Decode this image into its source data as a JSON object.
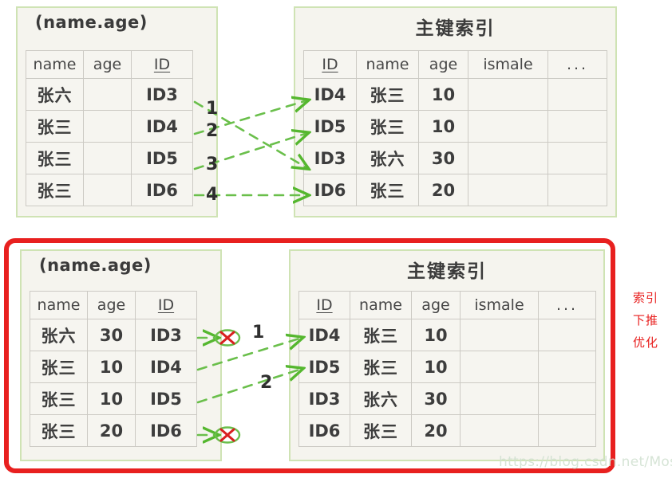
{
  "diagram": {
    "title_secondary_index": "(name.age)",
    "title_primary_index": "主键索引",
    "watermark": "https://blog.csdn.net/MosBest",
    "annotation_lines": [
      "索引",
      "下推",
      "优化"
    ],
    "colors": {
      "panel_border": "#cfe3b4",
      "panel_fill": "#f5f4ee",
      "arrow": "#6abf4b",
      "highlight_box": "#e8201f",
      "annotation_text": "#e8201f",
      "text": "#3d3d3d",
      "watermark": "#cfe0cf"
    }
  },
  "top": {
    "secondary_index": {
      "title": "(name.age)",
      "headers": [
        "name",
        "age",
        "ID"
      ],
      "rows": [
        [
          "张六",
          "",
          "ID3"
        ],
        [
          "张三",
          "",
          "ID4"
        ],
        [
          "张三",
          "",
          "ID5"
        ],
        [
          "张三",
          "",
          "ID6"
        ]
      ]
    },
    "primary_index": {
      "title": "主键索引",
      "headers": [
        "ID",
        "name",
        "age",
        "ismale",
        "..."
      ],
      "rows": [
        [
          "ID4",
          "张三",
          "10",
          "",
          ""
        ],
        [
          "ID5",
          "张三",
          "10",
          "",
          ""
        ],
        [
          "ID3",
          "张六",
          "30",
          "",
          ""
        ],
        [
          "ID6",
          "张三",
          "20",
          "",
          ""
        ]
      ]
    },
    "step_labels": [
      "1",
      "2",
      "3",
      "4"
    ],
    "lookups": [
      {
        "label": "1",
        "from_row": 0,
        "from_id": "ID3",
        "to_row": 2,
        "to_id": "ID3",
        "blocked": false
      },
      {
        "label": "2",
        "from_row": 1,
        "from_id": "ID4",
        "to_row": 0,
        "to_id": "ID4",
        "blocked": false
      },
      {
        "label": "3",
        "from_row": 2,
        "from_id": "ID5",
        "to_row": 1,
        "to_id": "ID5",
        "blocked": false
      },
      {
        "label": "4",
        "from_row": 3,
        "from_id": "ID6",
        "to_row": 3,
        "to_id": "ID6",
        "blocked": false
      }
    ]
  },
  "bottom": {
    "secondary_index": {
      "title": "(name.age)",
      "headers": [
        "name",
        "age",
        "ID"
      ],
      "rows": [
        [
          "张六",
          "30",
          "ID3"
        ],
        [
          "张三",
          "10",
          "ID4"
        ],
        [
          "张三",
          "10",
          "ID5"
        ],
        [
          "张三",
          "20",
          "ID6"
        ]
      ]
    },
    "primary_index": {
      "title": "主键索引",
      "headers": [
        "ID",
        "name",
        "age",
        "ismale",
        "..."
      ],
      "rows": [
        [
          "ID4",
          "张三",
          "10",
          "",
          ""
        ],
        [
          "ID5",
          "张三",
          "10",
          "",
          ""
        ],
        [
          "ID3",
          "张六",
          "30",
          "",
          ""
        ],
        [
          "ID6",
          "张三",
          "20",
          "",
          ""
        ]
      ]
    },
    "step_labels": [
      "1",
      "2"
    ],
    "lookups": [
      {
        "label": "1",
        "from_row": 1,
        "from_id": "ID4",
        "to_row": 0,
        "to_id": "ID4",
        "blocked": false
      },
      {
        "label": "2",
        "from_row": 2,
        "from_id": "ID5",
        "to_row": 1,
        "to_id": "ID5",
        "blocked": false
      }
    ],
    "blocked": [
      {
        "from_row": 0,
        "from_id": "ID3",
        "blocked": true
      },
      {
        "from_row": 3,
        "from_id": "ID6",
        "blocked": true
      }
    ]
  }
}
